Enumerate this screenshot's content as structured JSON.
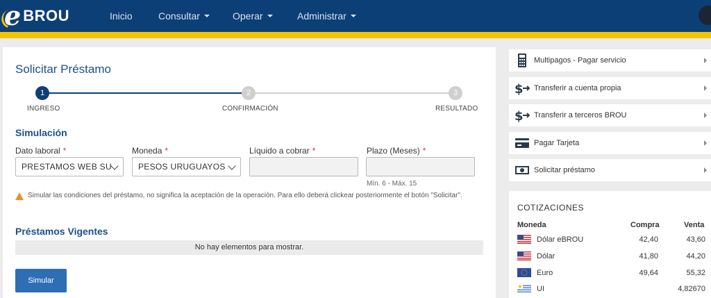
{
  "brand": {
    "text": "BROU"
  },
  "nav": [
    {
      "label": "Inicio",
      "dropdown": false
    },
    {
      "label": "Consultar",
      "dropdown": true
    },
    {
      "label": "Operar",
      "dropdown": true
    },
    {
      "label": "Administrar",
      "dropdown": true
    }
  ],
  "colors": {
    "header": "#0d3f77",
    "accent": "#f5c400",
    "primary_button": "#2e6eb5",
    "required": "#d9353b",
    "warning": "#e8912d"
  },
  "page": {
    "title": "Solicitar Préstamo"
  },
  "stepper": {
    "steps": [
      {
        "number": "1",
        "label": "INGRESO",
        "state": "active"
      },
      {
        "number": "2",
        "label": "CONFIRMACIÓN",
        "state": "pending"
      },
      {
        "number": "3",
        "label": "RESULTADO",
        "state": "pending"
      }
    ]
  },
  "simulation": {
    "title": "Simulación",
    "fields": {
      "dato_laboral": {
        "label": "Dato laboral",
        "required": "*",
        "value": "PRESTAMOS WEB SU"
      },
      "moneda": {
        "label": "Moneda",
        "required": "*",
        "value": "PESOS URUGUAYOS"
      },
      "liquido": {
        "label": "Líquido a cobrar",
        "required": "*",
        "value": ""
      },
      "plazo": {
        "label": "Plazo (Meses)",
        "required": "*",
        "value": "",
        "hint": "Mín. 6 - Máx. 15"
      }
    },
    "warning": "Simular las condiciones del préstamo, no significa la aceptación de la operación. Para ello deberá clickear posteriormente el botón \"Solicitar\"."
  },
  "loans": {
    "title": "Préstamos Vigentes",
    "empty_text": "No hay elementos para mostrar."
  },
  "actions": {
    "simulate_label": "Simular"
  },
  "quick_links": [
    {
      "label": "Multipagos - Pagar servicio",
      "icon": "calculator-icon"
    },
    {
      "label": "Transferir a cuenta propia",
      "icon": "dollar-transfer-icon"
    },
    {
      "label": "Transferir a terceros BROU",
      "icon": "dollar-transfer-icon"
    },
    {
      "label": "Pagar Tarjeta",
      "icon": "credit-card-icon"
    },
    {
      "label": "Solicitar préstamo",
      "icon": "banknote-icon"
    }
  ],
  "rates": {
    "title": "COTIZACIONES",
    "headers": {
      "currency": "Moneda",
      "buy": "Compra",
      "sell": "Venta"
    },
    "rows": [
      {
        "name": "Dólar eBROU",
        "buy": "42,40",
        "sell": "43,60",
        "flag": "us-flag-icon"
      },
      {
        "name": "Dólar",
        "buy": "41,80",
        "sell": "44,20",
        "flag": "us-flag-icon"
      },
      {
        "name": "Euro",
        "buy": "49,64",
        "sell": "55,32",
        "flag": "eu-flag-icon"
      },
      {
        "name": "UI",
        "buy": "",
        "sell": "4,82670",
        "flag": "uy-flag-icon"
      }
    ]
  }
}
